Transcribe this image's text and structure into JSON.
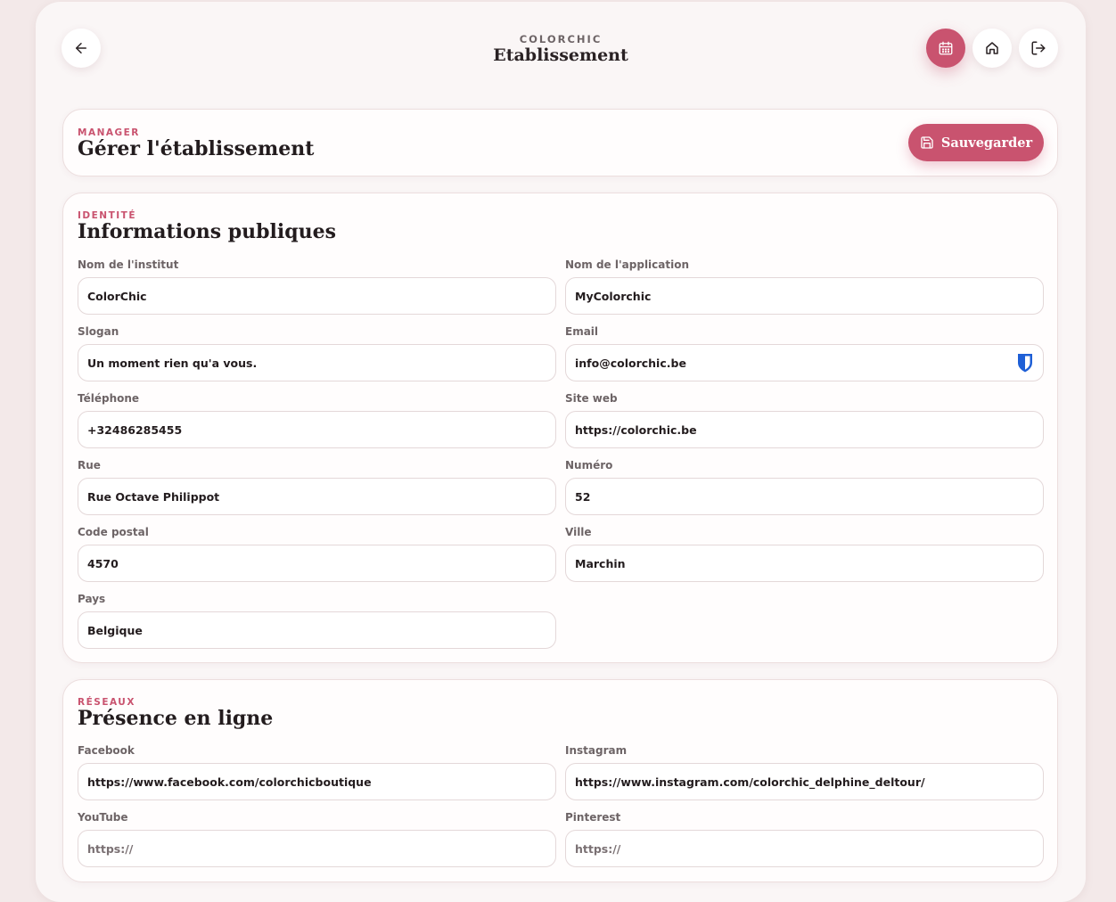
{
  "header": {
    "brand": "COLORCHIC",
    "title": "Etablissement",
    "icons": {
      "back": "arrow-left-icon",
      "calendar": "calendar-icon",
      "home": "home-icon",
      "logout": "logout-icon"
    }
  },
  "colors": {
    "accent": "#c9536f",
    "background": "#faf6f6",
    "text": "#231c1e"
  },
  "manager": {
    "eyebrow": "MANAGER",
    "title": "Gérer l'établissement",
    "save_label": "Sauvegarder"
  },
  "identite": {
    "eyebrow": "IDENTITÉ",
    "title": "Informations publiques",
    "fields": {
      "nom_institut": {
        "label": "Nom de l'institut",
        "value": "ColorChic"
      },
      "nom_application": {
        "label": "Nom de l'application",
        "value": "MyColorchic"
      },
      "slogan": {
        "label": "Slogan",
        "value": "Un moment rien qu'a vous."
      },
      "email": {
        "label": "Email",
        "value": "info@colorchic.be"
      },
      "telephone": {
        "label": "Téléphone",
        "value": "+32486285455"
      },
      "site_web": {
        "label": "Site web",
        "value": "https://colorchic.be"
      },
      "rue": {
        "label": "Rue",
        "value": "Rue Octave Philippot"
      },
      "numero": {
        "label": "Numéro",
        "value": "52"
      },
      "code_postal": {
        "label": "Code postal",
        "value": "4570"
      },
      "ville": {
        "label": "Ville",
        "value": "Marchin"
      },
      "pays": {
        "label": "Pays",
        "value": "Belgique"
      }
    }
  },
  "reseaux": {
    "eyebrow": "RÉSEAUX",
    "title": "Présence en ligne",
    "fields": {
      "facebook": {
        "label": "Facebook",
        "value": "https://www.facebook.com/colorchicboutique",
        "placeholder": ""
      },
      "instagram": {
        "label": "Instagram",
        "value": "https://www.instagram.com/colorchic_delphine_deltour/",
        "placeholder": ""
      },
      "youtube": {
        "label": "YouTube",
        "value": "",
        "placeholder": "https://"
      },
      "pinterest": {
        "label": "Pinterest",
        "value": "",
        "placeholder": "https://"
      }
    }
  }
}
